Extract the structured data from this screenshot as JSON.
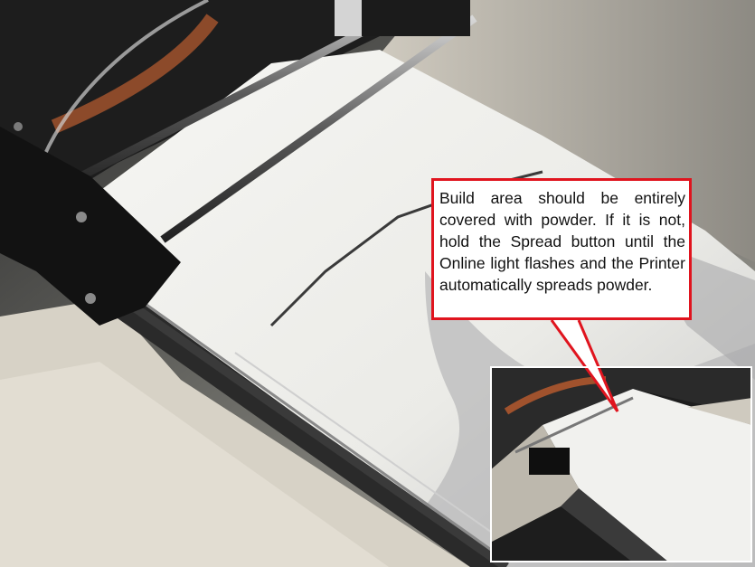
{
  "callout": {
    "text": "Build area should be entirely covered with powder. If it is not, hold the Spread button until the Online light flashes and the Printer automatically spreads powder."
  },
  "colors": {
    "callout_border": "#e0141e",
    "inset_border": "#ffffff",
    "powder": "#f2f2ee",
    "machine_dark": "#1e1e1e"
  },
  "scene": {
    "main_photo": "3d-printer-build-bed-with-powder",
    "inset_photo": "printer-build-bed-zoomed-out"
  }
}
